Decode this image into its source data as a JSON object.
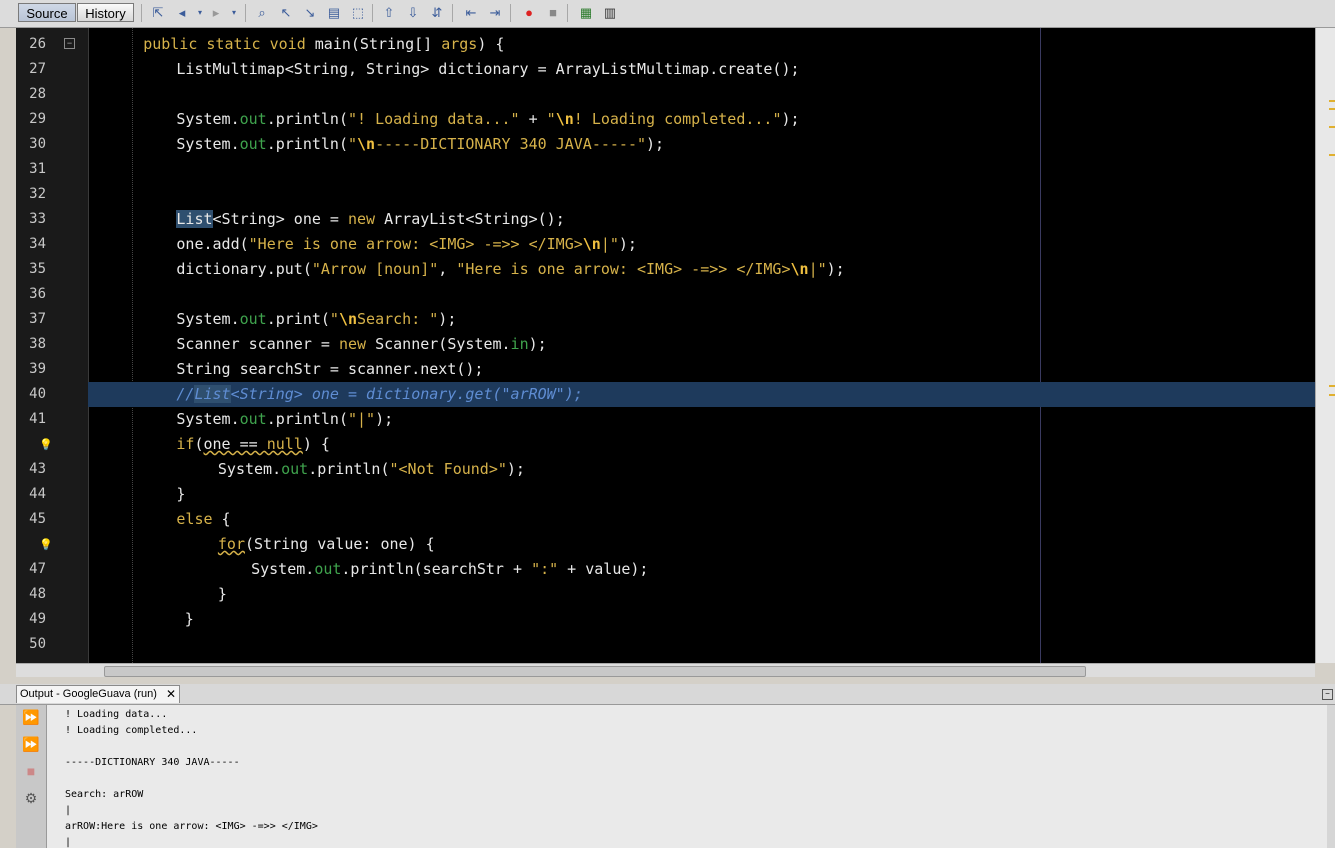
{
  "toolbar": {
    "tabs": [
      {
        "label": "Source"
      },
      {
        "label": "History"
      }
    ],
    "icons": [
      "last-edit-icon",
      "back-icon",
      "forward-icon",
      "find-icon",
      "find-prev-icon",
      "find-next-icon",
      "toggle-highlight-icon",
      "select-icon",
      "prev-bookmark-icon",
      "next-bookmark-icon",
      "toggle-bookmark-icon",
      "shift-left-icon",
      "shift-right-icon",
      "start-macro-icon",
      "stop-macro-icon",
      "comment-icon",
      "uncomment-icon"
    ]
  },
  "editor": {
    "line_numbers": [
      "26",
      "27",
      "28",
      "29",
      "30",
      "31",
      "32",
      "33",
      "34",
      "35",
      "36",
      "37",
      "38",
      "39",
      "40",
      "41",
      "",
      "43",
      "44",
      "45",
      "",
      "47",
      "48",
      "49",
      "50"
    ],
    "current_line": "40",
    "colors": {
      "keyword": "#d6b24a",
      "field": "#3fa34d",
      "comment": "#5f8dd3",
      "current_line_bg": "#1e3a5c"
    }
  },
  "output": {
    "tab_title": "Output - GoogleGuava (run)",
    "close": "✕",
    "lines": [
      "! Loading data...",
      "! Loading completed...",
      "",
      "-----DICTIONARY 340 JAVA-----",
      "",
      "Search: arROW",
      "|",
      "arROW:Here is one arrow: <IMG> -=>> </IMG>",
      "|"
    ]
  }
}
